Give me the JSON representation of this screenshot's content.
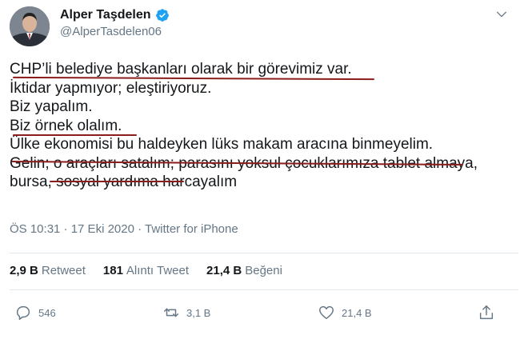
{
  "author": {
    "name": "Alper Taşdelen",
    "handle": "@AlperTasdelen06"
  },
  "tweet": {
    "lines": [
      "CHP’li belediye başkanları olarak bir görevimiz var.",
      "İktidar yapmıyor; eleştiriyoruz.",
      "Biz yapalım.",
      "Biz örnek olalım.",
      "Ülke ekonomisi bu haldeyken lüks makam aracına binmeyelim.",
      "Gelin; o araçları satalım; parasını yoksul çocuklarımıza tablet almaya,",
      "bursa, sosyal yardıma harcayalım"
    ],
    "meta": "ÖS 10:31 · 17 Eki 2020 · Twitter for iPhone"
  },
  "stats": {
    "retweets_count": "2,9 B",
    "retweets_label": "Retweet",
    "quotes_count": "181",
    "quotes_label": "Alıntı Tweet",
    "likes_count": "21,4 B",
    "likes_label": "Beğeni"
  },
  "actions": {
    "reply_count": "546",
    "retweet_count": "3,1 B",
    "like_count": "21,4 B"
  },
  "colors": {
    "underline": "#8b1d1d",
    "verified": "#1da1f2",
    "muted": "#657786"
  },
  "icons": [
    "verified-badge-icon",
    "chevron-down-icon",
    "reply-icon",
    "retweet-icon",
    "heart-icon",
    "share-icon"
  ]
}
